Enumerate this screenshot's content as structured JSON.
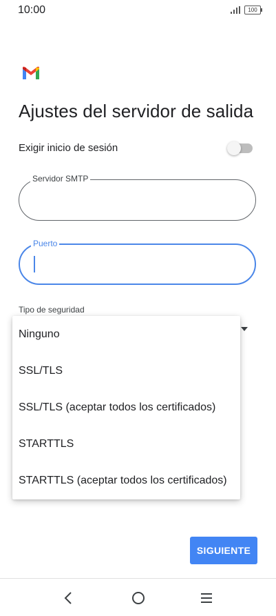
{
  "status": {
    "time": "10:00",
    "battery": "100"
  },
  "page": {
    "title": "Ajustes del servidor de salida"
  },
  "login": {
    "label": "Exigir inicio de sesión",
    "enabled": false
  },
  "smtp": {
    "label": "Servidor SMTP",
    "value": ""
  },
  "port": {
    "label": "Puerto",
    "value": ""
  },
  "security": {
    "label": "Tipo de seguridad",
    "options": [
      "Ninguno",
      "SSL/TLS",
      "SSL/TLS (aceptar todos los certificados)",
      "STARTTLS",
      "STARTTLS (aceptar todos los certificados)"
    ]
  },
  "actions": {
    "next_label": "SIGUIENTE"
  },
  "colors": {
    "accent": "#4285f4",
    "focus": "#4a86e8"
  }
}
